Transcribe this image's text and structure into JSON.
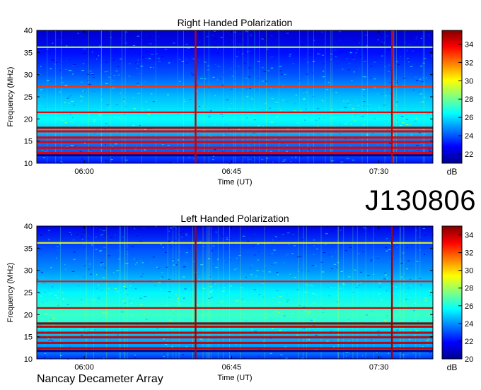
{
  "figure_id": "J130806",
  "footer_label": "Nancay Decameter Array",
  "colormap_stops": [
    "#00008f",
    "#0000ff",
    "#0080ff",
    "#00ffff",
    "#80ff80",
    "#ffff00",
    "#ff8000",
    "#ff0000",
    "#800000"
  ],
  "chart_data": [
    {
      "type": "heatmap",
      "title": "Right Handed Polarization",
      "xlabel": "Time (UT)",
      "ylabel": "Frequency (MHz)",
      "xticks": [
        "06:00",
        "06:45",
        "07:30"
      ],
      "xtick_minutes": [
        360,
        405,
        450
      ],
      "xlim_minutes": [
        345.5,
        466.5
      ],
      "ylim": [
        10,
        40
      ],
      "yticks": [
        10,
        15,
        20,
        25,
        30,
        35,
        40
      ],
      "colorbar_label": "dB",
      "colorbar_range": [
        21,
        35.5
      ],
      "colorbar_ticks": [
        22,
        24,
        26,
        28,
        30,
        32,
        34
      ],
      "background_level": [
        {
          "freq": 10,
          "db": 23
        },
        {
          "freq": 12,
          "db": 24
        },
        {
          "freq": 15,
          "db": 24.5
        },
        {
          "freq": 18,
          "db": 26
        },
        {
          "freq": 20,
          "db": 26.5
        },
        {
          "freq": 25,
          "db": 25.5
        },
        {
          "freq": 30,
          "db": 24
        },
        {
          "freq": 35,
          "db": 23
        },
        {
          "freq": 40,
          "db": 22
        }
      ],
      "interference_bands_mhz": [
        {
          "freq": 11.8,
          "db": 21
        },
        {
          "freq": 12.3,
          "db": 34
        },
        {
          "freq": 13.5,
          "db": 34
        },
        {
          "freq": 14.8,
          "db": 34
        },
        {
          "freq": 15.8,
          "db": 34
        },
        {
          "freq": 17.2,
          "db": 34
        },
        {
          "freq": 18.0,
          "db": 35
        },
        {
          "freq": 21.5,
          "db": 34
        },
        {
          "freq": 27.3,
          "db": 33
        },
        {
          "freq": 36.2,
          "db": 29
        }
      ],
      "broadband_spikes_minutes": [
        394.0,
        454.0
      ]
    },
    {
      "type": "heatmap",
      "title": "Left Handed Polarization",
      "xlabel": "Time (UT)",
      "ylabel": "Frequency (MHz)",
      "xticks": [
        "06:00",
        "06:45",
        "07:30"
      ],
      "xtick_minutes": [
        360,
        405,
        450
      ],
      "xlim_minutes": [
        345.5,
        466.5
      ],
      "ylim": [
        10,
        40
      ],
      "yticks": [
        10,
        15,
        20,
        25,
        30,
        35,
        40
      ],
      "colorbar_label": "dB",
      "colorbar_range": [
        20,
        35
      ],
      "colorbar_ticks": [
        20,
        22,
        24,
        26,
        28,
        30,
        32,
        34
      ],
      "background_level": [
        {
          "freq": 10,
          "db": 22.5
        },
        {
          "freq": 12,
          "db": 24
        },
        {
          "freq": 15,
          "db": 24.5
        },
        {
          "freq": 18,
          "db": 26
        },
        {
          "freq": 20,
          "db": 26.5
        },
        {
          "freq": 25,
          "db": 25.5
        },
        {
          "freq": 30,
          "db": 24
        },
        {
          "freq": 35,
          "db": 23
        },
        {
          "freq": 40,
          "db": 21.5
        }
      ],
      "interference_bands_mhz": [
        {
          "freq": 11.8,
          "db": 20
        },
        {
          "freq": 12.4,
          "db": 34
        },
        {
          "freq": 13.6,
          "db": 34
        },
        {
          "freq": 14.9,
          "db": 34
        },
        {
          "freq": 15.9,
          "db": 34
        },
        {
          "freq": 17.3,
          "db": 34
        },
        {
          "freq": 18.0,
          "db": 35
        },
        {
          "freq": 21.5,
          "db": 34
        },
        {
          "freq": 27.5,
          "db": 33
        },
        {
          "freq": 36.2,
          "db": 29
        }
      ],
      "broadband_spikes_minutes": [
        394.0,
        454.0
      ]
    }
  ]
}
